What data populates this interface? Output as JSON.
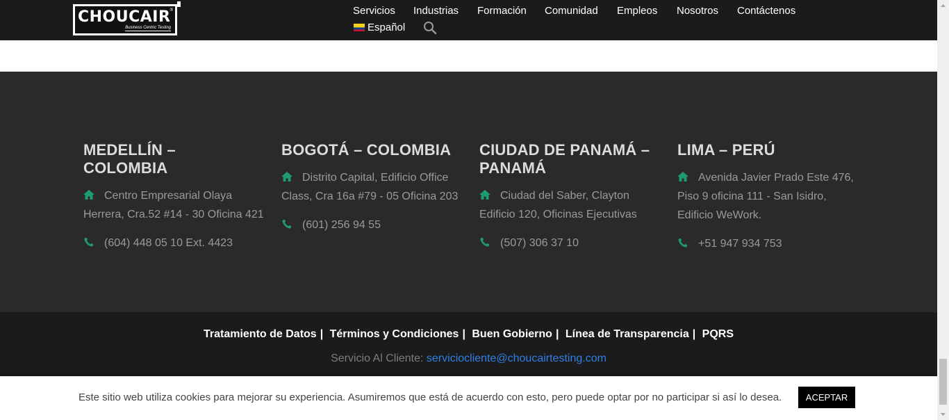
{
  "header": {
    "logo_text": "CHOUCAIR",
    "logo_reg": "®",
    "logo_tagline": "Business Centric Testing",
    "nav": [
      "Servicios",
      "Industrias",
      "Formación",
      "Comunidad",
      "Empleos",
      "Nosotros",
      "Contáctenos"
    ],
    "language": "Español",
    "search_icon": "search-icon"
  },
  "offices": [
    {
      "city": "MEDELLÍN – COLOMBIA",
      "address": "Centro Empresarial Olaya Herrera, Cra.52 #14 - 30 Oficina 421",
      "phone": "(604) 448 05 10 Ext. 4423"
    },
    {
      "city": "BOGOTÁ – COLOMBIA",
      "address": "Distrito Capital, Edificio Office Class, Cra 16a #79 - 05 Oficina 203",
      "phone": "(601) 256 94 55"
    },
    {
      "city": "CIUDAD DE PANAMÁ – PANAMÁ",
      "address": "Ciudad del Saber, Clayton Edificio 120, Oficinas Ejecutivas",
      "phone": "(507) 306 37 10"
    },
    {
      "city": "LIMA – PERÚ",
      "address": "Avenida Javier Prado Este 476, Piso 9 oficina 111 - San Isidro, Edificio WeWork.",
      "phone": "+51 947 934 753"
    }
  ],
  "footer": {
    "links": [
      "Tratamiento de Datos",
      "Términos y Condiciones",
      "Buen Gobierno",
      "Línea de Transparencia",
      "PQRS"
    ],
    "separator": "|",
    "service_label": "Servicio Al Cliente:",
    "service_email": "serviciocliente@choucairtesting.com"
  },
  "cookie": {
    "text": "Este sitio web utiliza cookies para mejorar su experiencia. Asumiremos que está de acuerdo con esto, pero puede optar por no participar si así lo desea.",
    "accept_label": "ACEPTAR"
  },
  "colors": {
    "icon_green": "#1f9b74",
    "dark_bg": "#2a2a2a",
    "footer_bg": "#1b1b1b",
    "link_blue": "#2f7fe6"
  }
}
